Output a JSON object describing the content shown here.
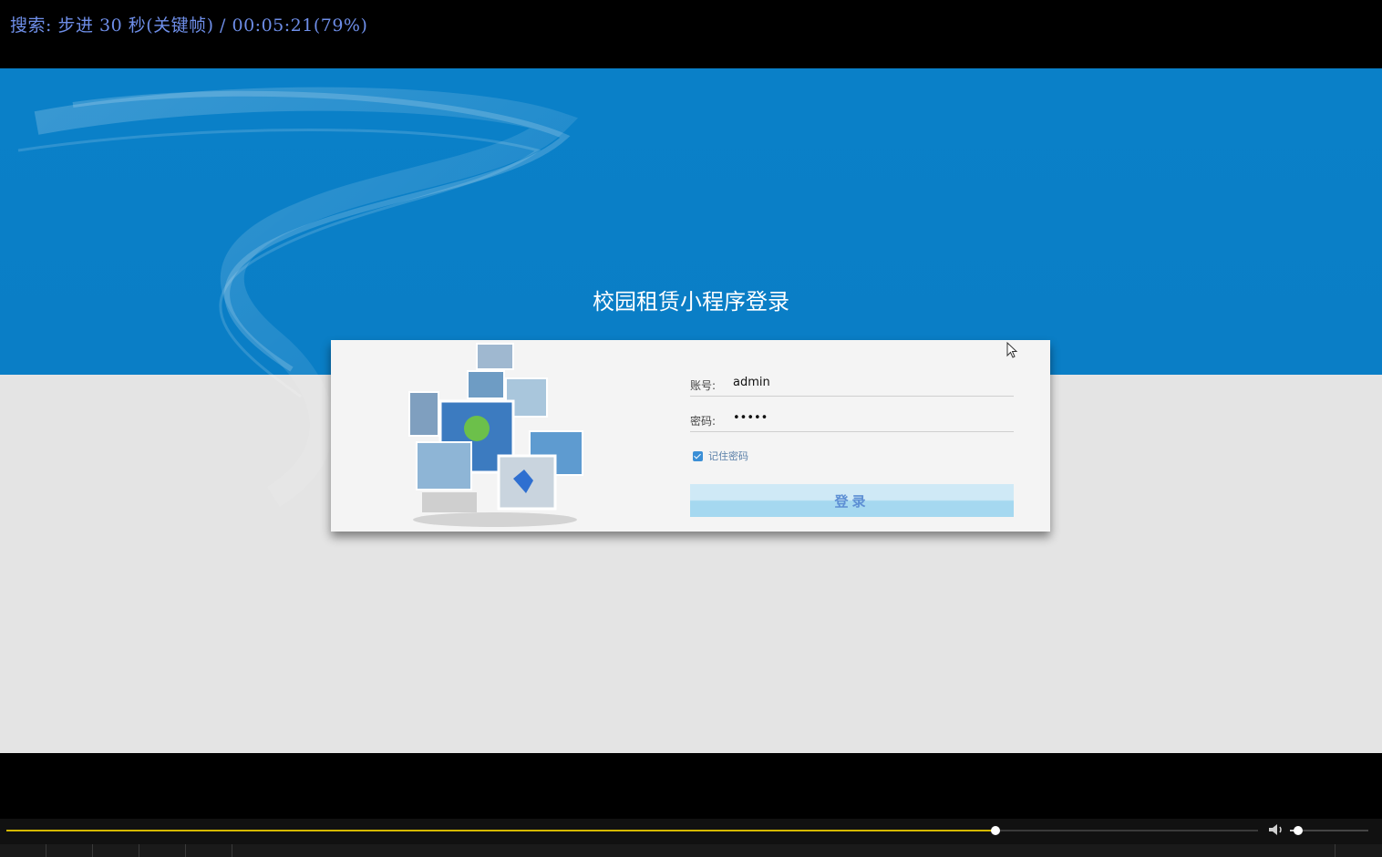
{
  "osd": {
    "text": "搜索: 步进 30 秒(关键帧) / 00:05:21(79%)"
  },
  "page": {
    "title": "校园租赁小程序登录"
  },
  "login": {
    "account_label": "账号:",
    "account_value": "admin",
    "password_label": "密码:",
    "password_value": "•••••",
    "remember_label": "记住密码",
    "remember_checked": true,
    "submit_label": "登录"
  },
  "player": {
    "progress_percent": 79,
    "volume_fraction": 0.1,
    "colors": {
      "seek": "#d4b800",
      "osd": "#6e8ee8"
    },
    "icons": [
      "volume-icon"
    ]
  }
}
